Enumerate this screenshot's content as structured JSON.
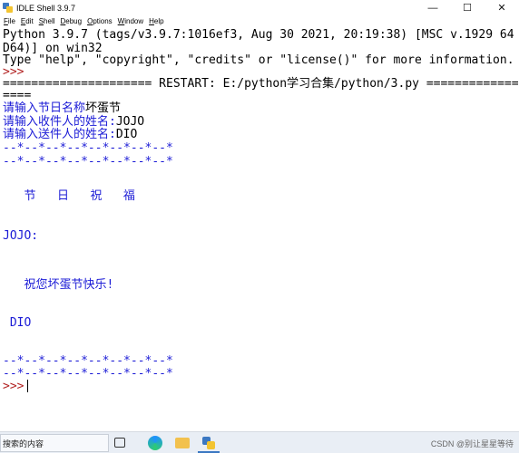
{
  "window": {
    "title": "IDLE Shell 3.9.7",
    "controls": {
      "minimize": "—",
      "maximize": "☐",
      "close": "✕"
    }
  },
  "menu": [
    {
      "key": "F",
      "rest": "ile"
    },
    {
      "key": "E",
      "rest": "dit"
    },
    {
      "key": "S",
      "rest": "hell"
    },
    {
      "key": "D",
      "rest": "ebug"
    },
    {
      "key": "O",
      "rest": "ptions"
    },
    {
      "key": "W",
      "rest": "indow"
    },
    {
      "key": "H",
      "rest": "elp"
    }
  ],
  "shell": {
    "banner1": "Python 3.9.7 (tags/v3.9.7:1016ef3, Aug 30 2021, 20:19:38) [MSC v.1929 64 bit (AM",
    "banner2": "D64)] on win32",
    "banner3": "Type \"help\", \"copyright\", \"credits\" or \"license()\" for more information.",
    "prompt_start": ">>>",
    "restart1": "===================== RESTART: E:/python学习合集/python/3.py ==================",
    "restart2": "====",
    "input1_prompt": "请输入节日名称",
    "input1_value": "坏蛋节",
    "input2_prompt": "请输入收件人的姓名:",
    "input2_value": "JOJO",
    "input3_prompt": "请输入送件人的姓名:",
    "input3_value": "DIO",
    "border_top1": "--*--*--*--*--*--*--*--*",
    "border_top2": "--*--*--*--*--*--*--*--*",
    "greeting_title": "   节   日   祝   福",
    "recipient_line": "JOJO:",
    "message_line": "   祝您坏蛋节快乐!",
    "sender_line": " DIO",
    "border_bottom1": "--*--*--*--*--*--*--*--*",
    "border_bottom2": "--*--*--*--*--*--*--*--*",
    "prompt_end": ">>>"
  },
  "taskbar": {
    "search_placeholder": "搜索的内容",
    "watermark": "CSDN @别让星星等待"
  }
}
